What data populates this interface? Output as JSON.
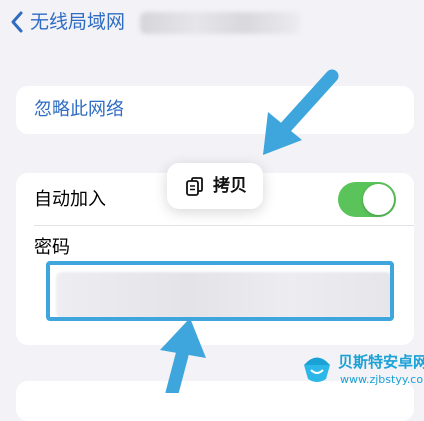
{
  "nav": {
    "back_label": "无线局域网",
    "back_icon": "chevron-left-icon"
  },
  "actions": {
    "forget_label": "忽略此网络"
  },
  "settings": {
    "auto_join_label": "自动加入",
    "auto_join_on": true,
    "password_label": "密码"
  },
  "popup": {
    "copy_label": "拷贝",
    "copy_icon": "copy-icon"
  },
  "watermark": {
    "title": "贝斯特安卓网",
    "url": "www.zjbstyy.com"
  },
  "colors": {
    "link_blue": "#2f6cc3",
    "toggle_green": "#5ac45a",
    "annotation_blue": "#3ea6dd",
    "background": "#f2f2f7"
  }
}
